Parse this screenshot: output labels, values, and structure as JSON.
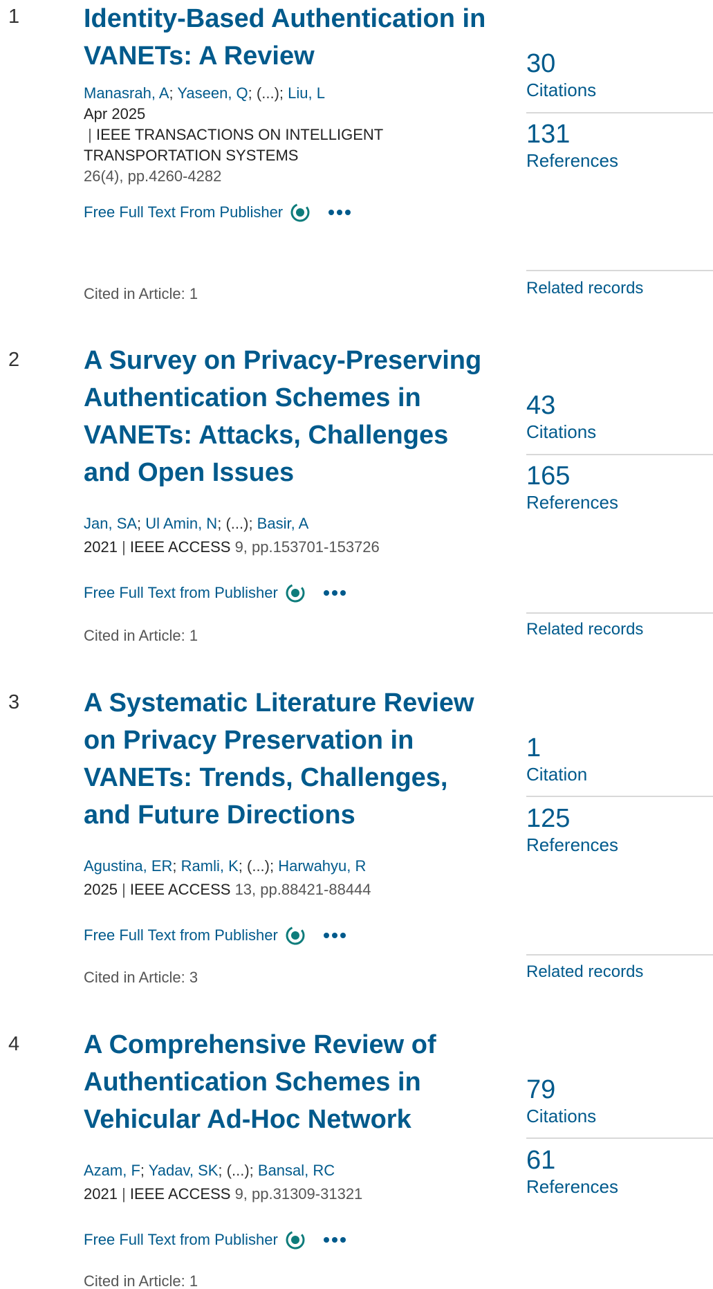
{
  "records": [
    {
      "number": "1",
      "title": "Identity-Based Authentication in VANETs: A Review",
      "authors": [
        "Manasrah, A",
        "Yaseen, Q",
        "(...)",
        "Liu, L"
      ],
      "pub_date": "Apr 2025",
      "journal": "IEEE TRANSACTIONS ON INTELLIGENT TRANSPORTATION SYSTEMS",
      "volume": "26(4), pp.4260-4282",
      "full_text": "Free Full Text From Publisher",
      "cited_in_article": "Cited in Article: 1",
      "citations_count": "30",
      "citations_label": "Citations",
      "references_count": "131",
      "references_label": "References",
      "related": "Related records"
    },
    {
      "number": "2",
      "title": "A Survey on Privacy-Preserving Authentication Schemes in VANETs: Attacks, Challenges and Open Issues",
      "authors": [
        "Jan, SA",
        "Ul Amin, N",
        "(...)",
        "Basir, A"
      ],
      "pub_date": "2021",
      "journal": "IEEE ACCESS",
      "volume": "9, pp.153701-153726",
      "full_text": "Free Full Text from Publisher",
      "cited_in_article": "Cited in Article: 1",
      "citations_count": "43",
      "citations_label": "Citations",
      "references_count": "165",
      "references_label": "References",
      "related": "Related records"
    },
    {
      "number": "3",
      "title": "A Systematic Literature Review on Privacy Preservation in VANETs: Trends, Challenges, and Future Directions",
      "authors": [
        "Agustina, ER",
        "Ramli, K",
        "(...)",
        "Harwahyu, R"
      ],
      "pub_date": "2025",
      "journal": "IEEE ACCESS",
      "volume": "13, pp.88421-88444",
      "full_text": "Free Full Text from Publisher",
      "cited_in_article": "Cited in Article: 3",
      "citations_count": "1",
      "citations_label": "Citation",
      "references_count": "125",
      "references_label": "References",
      "related": "Related records"
    },
    {
      "number": "4",
      "title": "A Comprehensive Review of Authentication Schemes in Vehicular Ad-Hoc Network",
      "authors": [
        "Azam, F",
        "Yadav, SK",
        "(...)",
        "Bansal, RC"
      ],
      "pub_date": "2021",
      "journal": "IEEE ACCESS",
      "volume": "9, pp.31309-31321",
      "full_text": "Free Full Text from Publisher",
      "cited_in_article": "Cited in Article: 1",
      "citations_count": "79",
      "citations_label": "Citations",
      "references_count": "61",
      "references_label": "References"
    }
  ],
  "colors": {
    "link": "#005A8C",
    "accent_icon": "#0E7C7B",
    "divider": "#d8d8d8"
  }
}
